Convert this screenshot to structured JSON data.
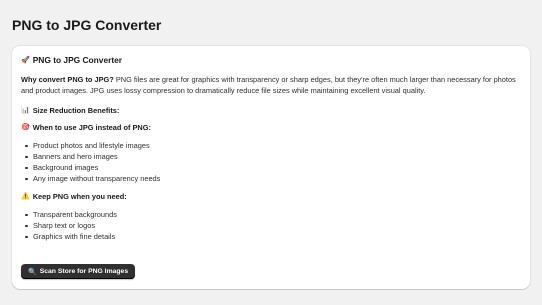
{
  "page": {
    "title": "PNG to JPG Converter"
  },
  "card": {
    "heading": "PNG to JPG Converter",
    "heading_icon": "rocket-emoji",
    "intro_bold": "Why convert PNG to JPG?",
    "intro_text": " PNG files are great for graphics with transparency or sharp edges, but they're often much larger than necessary for photos and product images. JPG uses lossy compression to dramatically reduce file sizes while maintaining excellent visual quality.",
    "size_heading": "Size Reduction Benefits:",
    "size_icon": "bar-chart-emoji",
    "when_jpg_heading": "When to use JPG instead of PNG:",
    "when_jpg_icon": "target-emoji",
    "jpg_items": [
      "Product photos and lifestyle images",
      "Banners and hero images",
      "Background images",
      "Any image without transparency needs"
    ],
    "keep_png_heading": "Keep PNG when you need:",
    "keep_png_icon": "warning-emoji",
    "png_items": [
      "Transparent backgrounds",
      "Sharp text or logos",
      "Graphics with fine details"
    ],
    "scan_button_label": "Scan Store for PNG Images",
    "scan_button_icon": "magnifier-emoji"
  },
  "colors": {
    "background": "#f1f1f1",
    "card": "#ffffff",
    "button": "#303030"
  }
}
